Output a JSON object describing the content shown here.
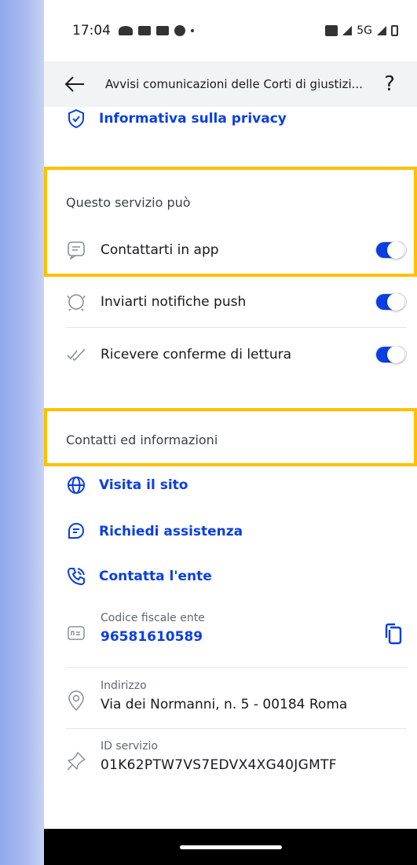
{
  "status_bar": {
    "time": "17:04",
    "network": "5G"
  },
  "app_bar": {
    "title": "Avvisi comunicazioni delle Corti di giustizi...",
    "back_icon": "arrow-left-icon",
    "help_icon": "question-mark-icon"
  },
  "privacy_link": {
    "label": "Informativa sulla privacy",
    "icon": "shield-check-icon"
  },
  "permissions": {
    "title": "Questo servizio può",
    "items": [
      {
        "label": "Contattarti in app",
        "icon": "message-icon",
        "enabled": true
      },
      {
        "label": "Inviarti notifiche push",
        "icon": "bell-icon",
        "enabled": true
      },
      {
        "label": "Ricevere conferme di lettura",
        "icon": "double-check-icon",
        "enabled": true
      }
    ]
  },
  "contacts": {
    "title": "Contatti ed informazioni",
    "links": [
      {
        "label": "Visita il sito",
        "icon": "globe-icon"
      },
      {
        "label": "Richiedi assistenza",
        "icon": "chat-icon"
      },
      {
        "label": "Contatta l'ente",
        "icon": "phone-icon"
      }
    ],
    "fiscal_code": {
      "label": "Codice fiscale ente",
      "value": "96581610589",
      "icon": "id-card-icon"
    },
    "address": {
      "label": "Indirizzo",
      "value": "Via dei Normanni, n. 5 - 00184 Roma",
      "icon": "location-pin-icon"
    },
    "service_id": {
      "label": "ID servizio",
      "value": "01K62PTW7VS7EDVX4XG40JGMTF",
      "icon": "pin-icon"
    }
  },
  "colors": {
    "accent": "#0b3ee3",
    "highlight": "#ffc000"
  }
}
